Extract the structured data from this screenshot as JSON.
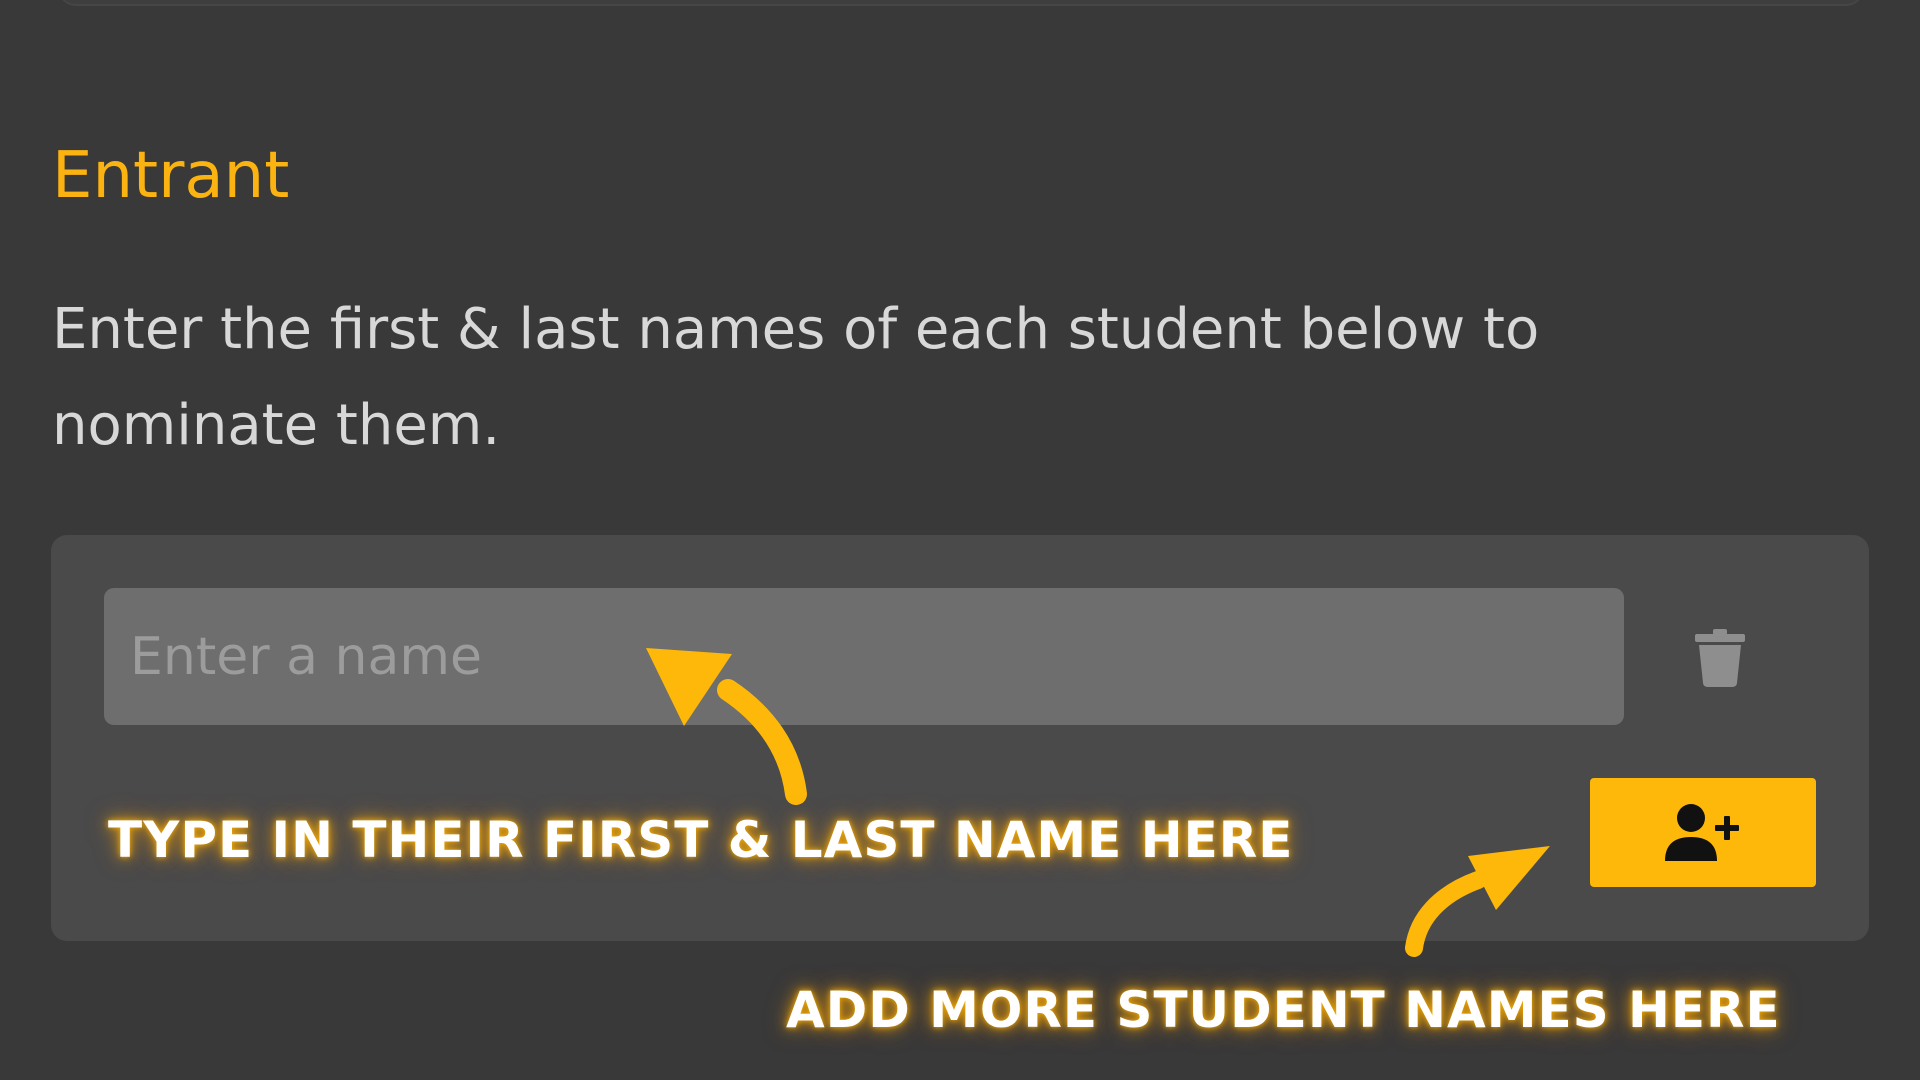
{
  "page": {
    "background_color": "#393939",
    "accent_color": "#fbb311"
  },
  "section": {
    "title": "Entrant",
    "description": "Enter the first & last names of each student below to nominate them."
  },
  "entrant_form": {
    "name_input": {
      "value": "",
      "placeholder": "Enter a name"
    },
    "delete_icon": "trash-icon",
    "add_icon": "add-user-icon"
  },
  "annotations": {
    "type_name_hint": "TYPE IN THEIR FIRST & LAST NAME HERE",
    "add_more_hint": "ADD MORE STUDENT NAMES HERE"
  }
}
